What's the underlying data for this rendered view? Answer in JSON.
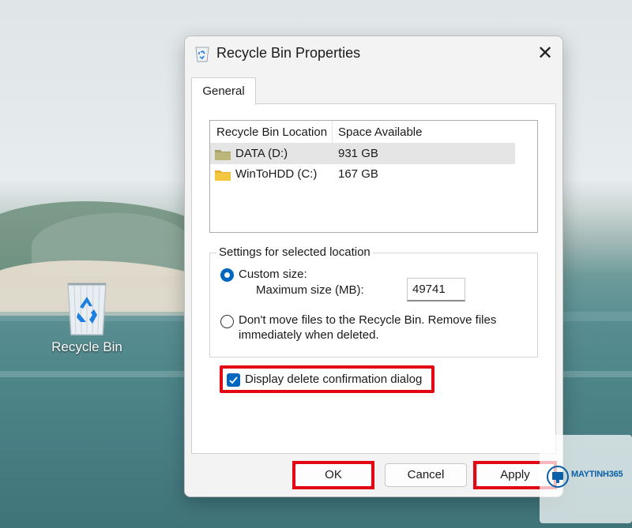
{
  "desktop": {
    "icon_label": "Recycle Bin"
  },
  "dialog": {
    "title": "Recycle Bin Properties",
    "close_glyph": "✕",
    "title_icon": "recycle-bin-icon",
    "tab": "General",
    "list": {
      "headers": [
        "Recycle Bin Location",
        "Space Available"
      ],
      "rows": [
        {
          "name": "DATA (D:)",
          "space": "931 GB",
          "selected": true,
          "folder_color": "#a8a26a"
        },
        {
          "name": "WinToHDD (C:)",
          "space": "167 GB",
          "selected": false,
          "folder_color": "#f3c640"
        }
      ]
    },
    "settings": {
      "group_title": "Settings for selected location",
      "custom_size_label": "Custom size:",
      "custom_size_selected": true,
      "max_size_label": "Maximum size (MB):",
      "max_size_value": "49741",
      "dont_move_line1": "Don't move files to the Recycle Bin. Remove files",
      "dont_move_line2": "immediately when deleted.",
      "dont_move_selected": false
    },
    "confirm": {
      "label": "Display delete confirmation dialog",
      "checked": true
    },
    "buttons": {
      "ok": "OK",
      "cancel": "Cancel",
      "apply": "Apply"
    }
  },
  "colors": {
    "accent": "#0067c0",
    "highlight": "#e30613",
    "watermark_text": "#0a5fa8"
  },
  "watermark": {
    "text": "MAYTINH365"
  }
}
